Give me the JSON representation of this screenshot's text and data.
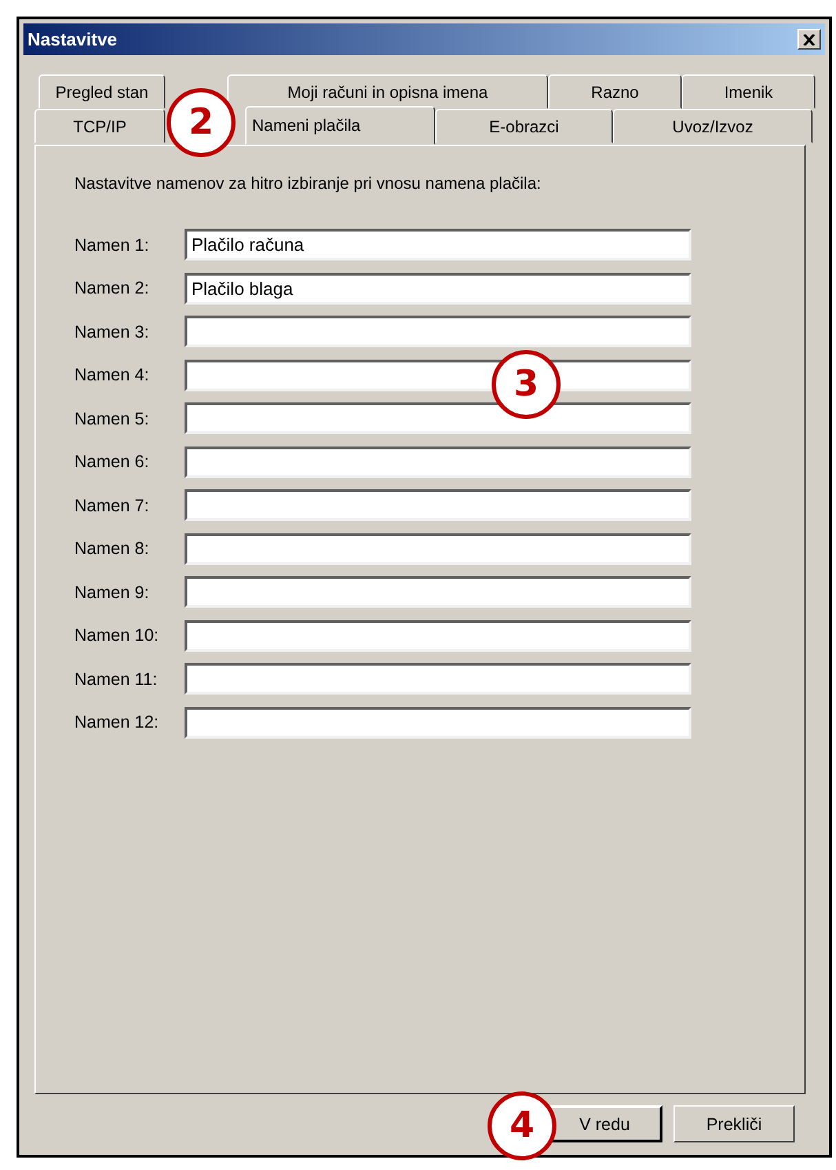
{
  "window": {
    "title": "Nastavitve"
  },
  "tab_rows": [
    [
      {
        "label": "Pregled stan",
        "selected": false
      },
      {
        "label": "Moji računi in opisna imena",
        "selected": false
      },
      {
        "label": "Razno",
        "selected": false
      },
      {
        "label": "Imenik",
        "selected": false
      }
    ],
    [
      {
        "label": "TCP/IP",
        "selected": false
      },
      {
        "label": "Nameni plačila",
        "selected": true
      },
      {
        "label": "E-obrazci",
        "selected": false
      },
      {
        "label": "Uvoz/Izvoz",
        "selected": false
      }
    ]
  ],
  "description": "Nastavitve namenov za hitro izbiranje pri vnosu namena plačila:",
  "fields": [
    {
      "label": "Namen 1:",
      "value": "Plačilo računa"
    },
    {
      "label": "Namen 2:",
      "value": "Plačilo blaga"
    },
    {
      "label": "Namen 3:"
    },
    {
      "label": "Namen 4:"
    },
    {
      "label": "Namen 5:"
    },
    {
      "label": "Namen 6:"
    },
    {
      "label": "Namen 7:"
    },
    {
      "label": "Namen 8:"
    },
    {
      "label": "Namen 9:"
    },
    {
      "label": "Namen 10:"
    },
    {
      "label": "Namen 11:"
    },
    {
      "label": "Namen 12:"
    }
  ],
  "buttons": [
    "V redu",
    "Prekliči"
  ],
  "callouts": [
    "2",
    "3",
    "4"
  ]
}
